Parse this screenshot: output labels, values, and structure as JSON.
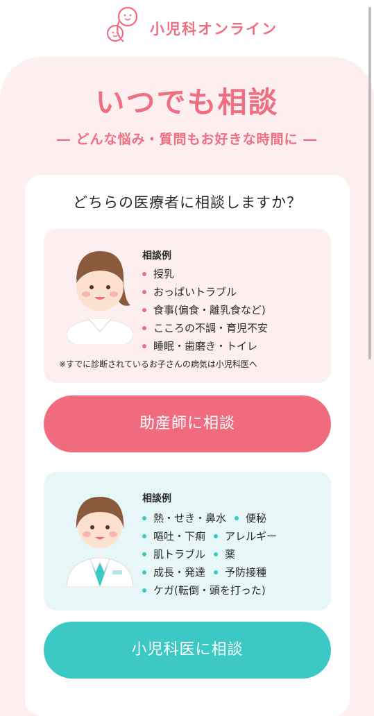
{
  "header": {
    "logo_text": "小児科オンライン"
  },
  "hero": {
    "title": "いつでも相談",
    "subtitle": "― どんな悩み・質問もお好きな時間に ―"
  },
  "question": "どちらの医療者に相談しますか？",
  "midwife": {
    "examples_label": "相談例",
    "examples": [
      "授乳",
      "おっぱいトラブル",
      "食事(偏食・離乳食など)",
      "こころの不調・育児不安",
      "睡眠・歯磨き・トイレ"
    ],
    "note": "※すでに診断されているお子さんの病気は小児科医へ",
    "button_label": "助産師に相談"
  },
  "pediatrician": {
    "examples_label": "相談例",
    "examples": [
      "熱・せき・鼻水",
      "便秘",
      "嘔吐・下痢",
      "アレルギー",
      "肌トラブル",
      "薬",
      "成長・発達",
      "予防接種",
      "ケガ(転倒・頭を打った)"
    ],
    "button_label": "小児科医に相談"
  },
  "colors": {
    "pink": "#ef6f82",
    "teal": "#3cc9c6",
    "bg_pink": "#fdeef0",
    "bg_teal": "#e7f6f6"
  }
}
